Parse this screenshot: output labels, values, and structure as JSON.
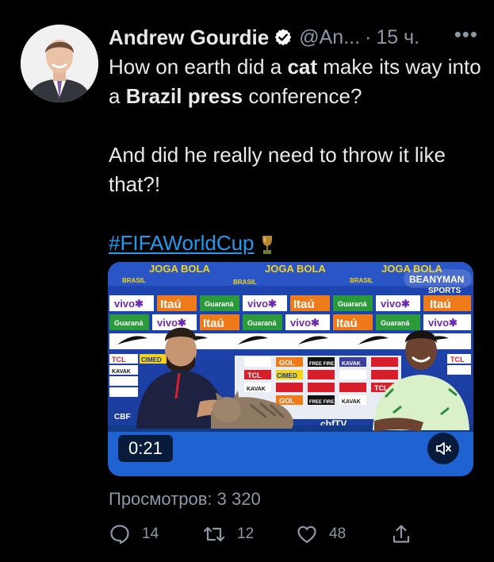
{
  "tweet": {
    "author_name": "Andrew Gourdie",
    "verified": true,
    "handle": "@An...",
    "separator": "·",
    "time": "15 ч.",
    "more_label": "•••",
    "text_line1_pre": "How on earth did a ",
    "text_line1_bold": "cat",
    "text_line1_post": " make its way into a ",
    "text_line2_bold": "Brazil press",
    "text_line2_post": " conference?",
    "text_para2": "And did he really need to throw it like that?!",
    "hashtag": "#FIFAWorldCup",
    "hashtag_emoji": "trophy-icon",
    "media": {
      "type": "video",
      "duration": "0:21",
      "backdrop_text": [
        "JOGA BOLA",
        "BRASIL",
        "BEANYMAN SPORTS",
        "vivo",
        "Itaú",
        "Guaraná",
        "TCL",
        "CIMED",
        "GOL",
        "FREE FIRE",
        "KAVAK",
        "CBF",
        "chfTV"
      ]
    },
    "views": "Просмотров: 3 320",
    "replies": "14",
    "retweets": "12",
    "likes": "48"
  },
  "colors": {
    "background": "#000000",
    "text": "#e7e9ea",
    "secondary": "#8b98a5",
    "link": "#1d9bf0",
    "verified_badge": "#ffffff",
    "backdrop_blue": "#1a3fa0"
  }
}
